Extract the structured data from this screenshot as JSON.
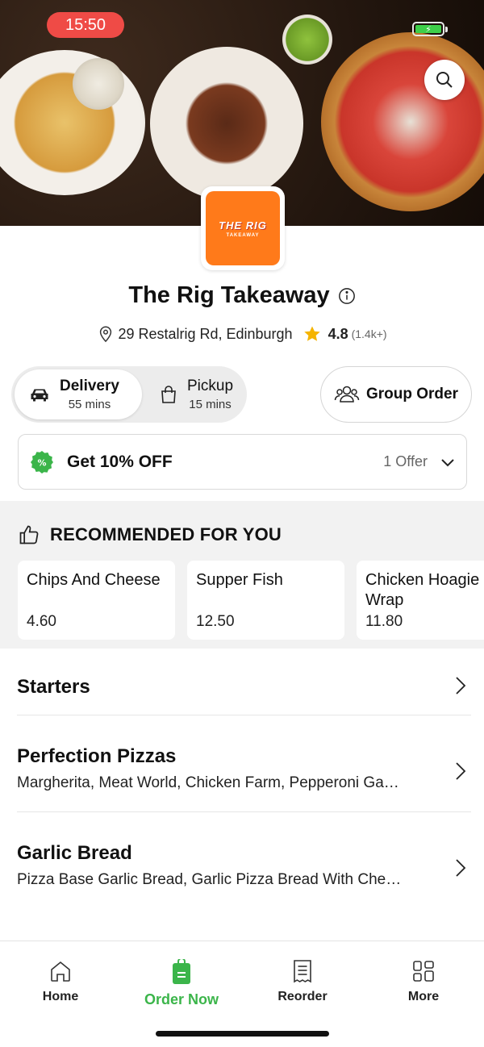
{
  "status_bar": {
    "time": "15:50"
  },
  "header": {
    "search_icon": "search-icon"
  },
  "restaurant": {
    "logo_text_main": "THE RIG",
    "logo_text_sub": "TAKEAWAY",
    "name": "The Rig Takeaway",
    "address": "29 Restalrig Rd, Edinburgh",
    "rating": "4.8",
    "rating_count": "(1.4k+)"
  },
  "order_modes": {
    "delivery": {
      "label": "Delivery",
      "time": "55 mins",
      "selected": true
    },
    "pickup": {
      "label": "Pickup",
      "time": "15 mins",
      "selected": false
    },
    "group_order_label": "Group Order"
  },
  "offer": {
    "title": "Get 10% OFF",
    "count": "1 Offer"
  },
  "recommended": {
    "title": "RECOMMENDED FOR YOU",
    "items": [
      {
        "name": "Chips And Cheese",
        "price": "4.60"
      },
      {
        "name": "Supper Fish",
        "price": "12.50"
      },
      {
        "name": "Chicken Hoagie Wrap",
        "price": "11.80"
      }
    ]
  },
  "categories": [
    {
      "title": "Starters",
      "subtitle": ""
    },
    {
      "title": "Perfection Pizzas",
      "subtitle": "Margherita, Meat World, Chicken Farm, Pepperoni Ga…"
    },
    {
      "title": "Garlic Bread",
      "subtitle": "Pizza Base Garlic Bread, Garlic Pizza Bread With Che…"
    }
  ],
  "bottom_nav": {
    "items": [
      {
        "label": "Home",
        "icon": "home-icon"
      },
      {
        "label": "Order Now",
        "icon": "order-bag-icon",
        "active": true
      },
      {
        "label": "Reorder",
        "icon": "receipt-icon"
      },
      {
        "label": "More",
        "icon": "grid-icon"
      }
    ]
  },
  "colors": {
    "accent_green": "#3bb54a",
    "status_red": "#ef4b46",
    "logo_orange": "#ff7a1a",
    "star_yellow": "#f5b400"
  }
}
